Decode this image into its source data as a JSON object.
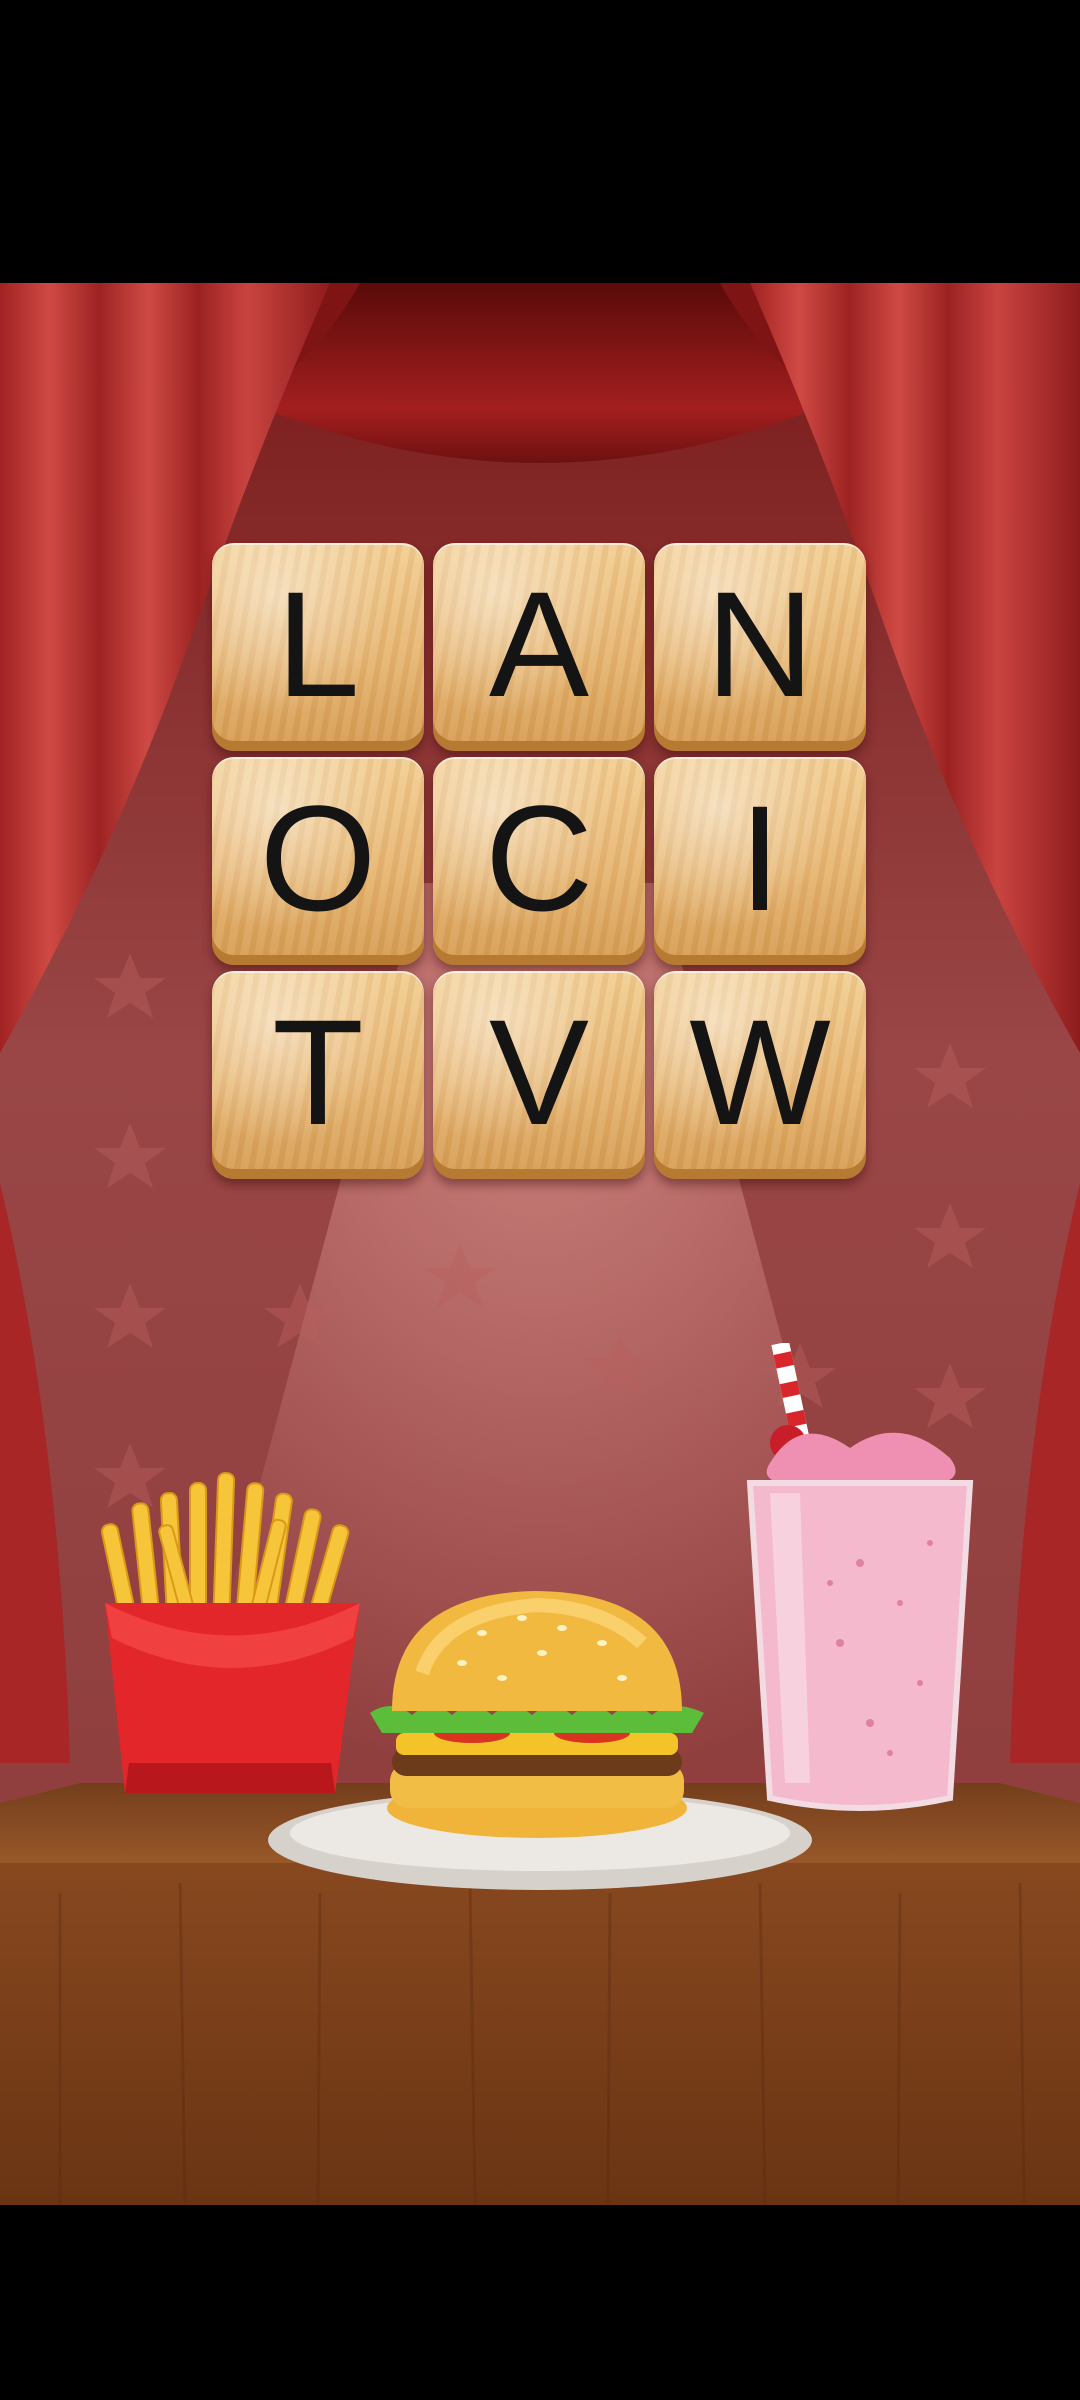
{
  "board": {
    "tiles": [
      "L",
      "A",
      "N",
      "O",
      "C",
      "I",
      "T",
      "V",
      "W"
    ]
  },
  "scene": {
    "items": [
      "french-fries",
      "burger",
      "strawberry-milkshake"
    ]
  },
  "colors": {
    "curtain": "#b52a2a",
    "backdrop": "#8e3b3b",
    "tile_wood": "#e7b672",
    "table_wood": "#7a3f18"
  }
}
